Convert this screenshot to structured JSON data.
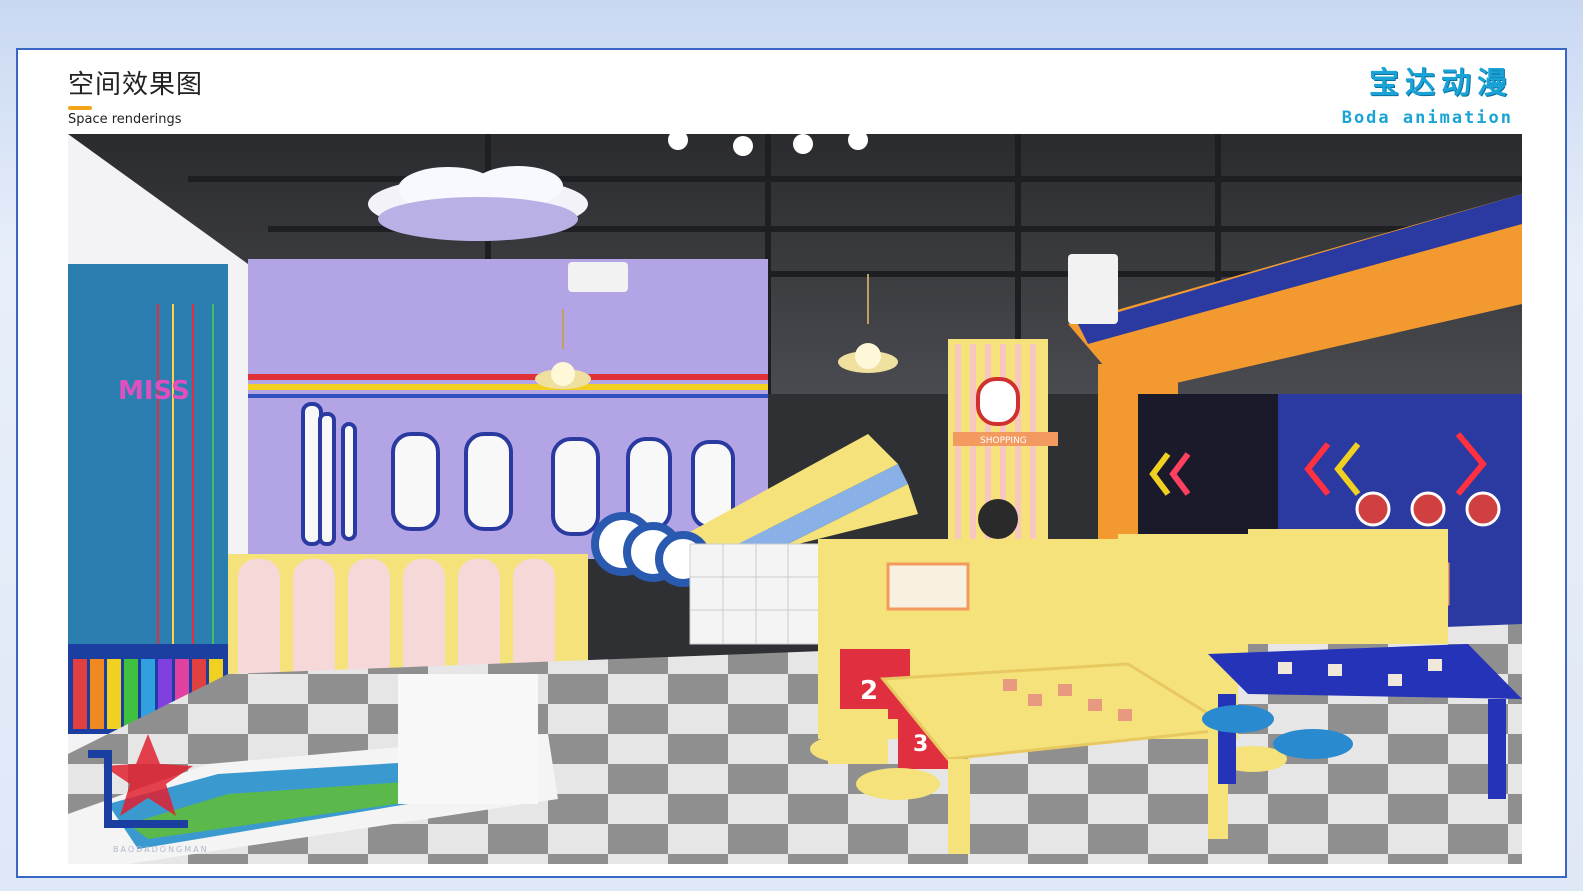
{
  "slide": {
    "title_cn": "空间效果图",
    "title_en": "Space renderings"
  },
  "brand": {
    "name_cn": "宝达动漫",
    "name_en": "Boda animation",
    "color": "#1aa3d6"
  },
  "scene": {
    "wall_sign": "MISS",
    "shop_sign": "SHOPPING",
    "block_numbers": [
      "2",
      "3"
    ],
    "watermark_text": "BAODADONGMAN"
  },
  "colors": {
    "frame_border": "#3a66c4",
    "accent_bar": "#f2a516",
    "wall_purple": "#b3a4e6",
    "floor_light": "#e8e8e8",
    "floor_dark": "#8a8a8a",
    "table_yellow": "#f5e27a",
    "table_blue": "#2433b8"
  }
}
